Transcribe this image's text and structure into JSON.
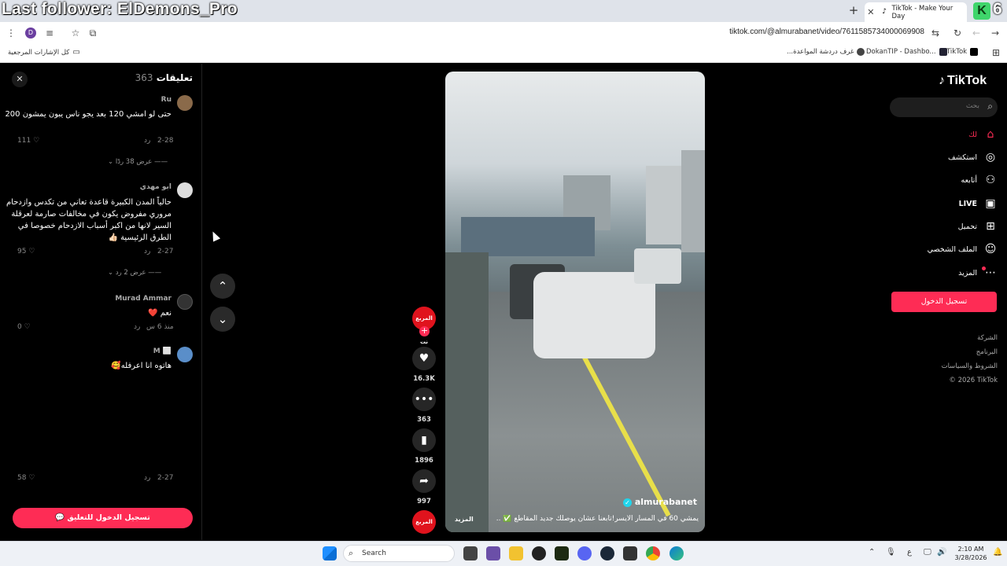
{
  "stream_overlay": "Last follower: ElDemons_Pro",
  "browser": {
    "tab_title": "TikTok - Make Your Day",
    "new_tab": "+",
    "profile_initial": "D",
    "url": "tiktok.com/@almurabanet/video/7611585734000069908",
    "extension_k": "K",
    "extension_6": "6"
  },
  "bookmarks": {
    "all_bookmarks": "كل الإشارات المرجعية",
    "items": [
      "...غرف دردشة المواعدة",
      "DokanTIP - Dashbo...",
      "TikTok"
    ]
  },
  "comments": {
    "title": "تعليقات",
    "count": "363",
    "items": [
      {
        "name": "Ru",
        "text": "حتى لو امشي 120 بعد يجو ناس يبون يمشون 200",
        "date": "2-28",
        "reply": "رد",
        "likes": "111",
        "views": "عرض 38 ردًا"
      },
      {
        "name": "ابو مهدي",
        "text": "حالياً المدن الكبيرة قاعدة تعاني من تكدس وازدحام مروري مفروض يكون في مخالفات صارمة لعرقلة السير لانها من اكبر أسباب الازدحام خصوصا في الطرق الرئيسية 👍🏻",
        "date": "2-27",
        "reply": "رد",
        "likes": "95",
        "views": "عرض 2 رد"
      },
      {
        "name": "Murad Ammar",
        "text": "نعم ❤️",
        "date": "منذ 6 س",
        "reply": "رد",
        "likes": "0"
      },
      {
        "name": "M ⬜",
        "text": "هاتوه انا اعرفله🥰",
        "date": "2-27",
        "reply": "رد",
        "likes": "58"
      }
    ],
    "login_to_comment": "تسجيل الدخول للتعليق"
  },
  "video": {
    "username": "almurabanet",
    "caption": "يمشي 60 في المسار الأيسر!تابعنا عشان يوصلك جديد المقاطع ✅ ...",
    "more": "المزيد",
    "profile_label": "المربع نت"
  },
  "actions": {
    "likes": "16.3K",
    "comments": "363",
    "saves": "1896",
    "shares": "997"
  },
  "sidebar": {
    "logo": "TikTok",
    "search_placeholder": "بحث",
    "items": [
      {
        "label": "لك",
        "icon": "home-icon"
      },
      {
        "label": "استكشف",
        "icon": "compass-icon"
      },
      {
        "label": "أتابعه",
        "icon": "following-icon"
      },
      {
        "label": "LIVE",
        "icon": "live-icon"
      },
      {
        "label": "تحميل",
        "icon": "upload-icon"
      },
      {
        "label": "الملف الشخصي",
        "icon": "profile-icon"
      },
      {
        "label": "المزيد",
        "icon": "more-icon"
      }
    ],
    "login": "تسجيل الدخول",
    "footer": [
      "الشركة",
      "البرنامج",
      "الشروط والسياسات",
      "© 2026 TikTok"
    ]
  },
  "taskbar": {
    "search": "Search",
    "time": "2:10 AM",
    "date": "3/28/2026",
    "lang": "ع"
  }
}
